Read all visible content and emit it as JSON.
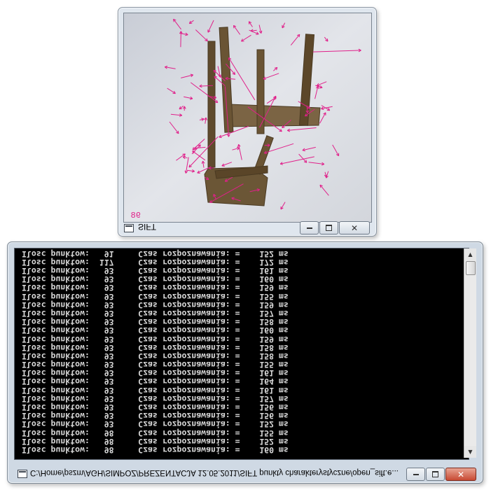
{
  "sift_window": {
    "title": "SIFT",
    "fps_overlay": "98",
    "keypoint_color": "#e0208a",
    "buttons": {
      "minimize": "minimize-icon",
      "maximize": "maximize-icon",
      "close": "close-icon"
    }
  },
  "console_window": {
    "title": "C:/Home/pszm/AGH/SIMPOZ/PREZENTACJA 12.05.2011/SIFT punkty charakterystyczne/open_sift.e...",
    "buttons": {
      "minimize": "minimize-icon",
      "maximize": "maximize-icon",
      "close": "close-icon"
    },
    "lines": [
      "Ilosc punktow:   98     Czas rozpoznawania: =    160 ms",
      "Ilosc punktow:   98     Czas rozpoznawania: =    152 ms",
      "Ilosc punktow:   98     Czas rozpoznawania: =    155 ms",
      "Ilosc punktow:   93     Czas rozpoznawania: =    152 ms",
      "Ilosc punktow:   93     Czas rozpoznawania: =    156 ms",
      "Ilosc punktow:   93     Czas rozpoznawania: =    156 ms",
      "Ilosc punktow:   93     Czas rozpoznawania: =    157 ms",
      "Ilosc punktow:   93     Czas rozpoznawania: =    161 ms",
      "Ilosc punktow:   93     Czas rozpoznawania: =    164 ms",
      "Ilosc punktow:   93     Czas rozpoznawania: =    161 ms",
      "Ilosc punktow:   93     Czas rozpoznawania: =    155 ms",
      "Ilosc punktow:   93     Czas rozpoznawania: =    158 ms",
      "Ilosc punktow:   93     Czas rozpoznawania: =    158 ms",
      "Ilosc punktow:   93     Czas rozpoznawania: =    159 ms",
      "Ilosc punktow:   93     Czas rozpoznawania: =    160 ms",
      "Ilosc punktow:   93     Czas rozpoznawania: =    158 ms",
      "Ilosc punktow:   93     Czas rozpoznawania: =    157 ms",
      "Ilosc punktow:   93     Czas rozpoznawania: =    159 ms",
      "Ilosc punktow:   93     Czas rozpoznawania: =    155 ms",
      "Ilosc punktow:   93     Czas rozpoznawania: =    159 ms",
      "Ilosc punktow:   93     Czas rozpoznawania: =    160 ms",
      "Ilosc punktow:   93     Czas rozpoznawania: =    161 ms",
      "Ilosc punktow:  117     Czas rozpoznawania: =    172 ms",
      "Ilosc punktow:   91     Czas rozpoznawania: =    152 ms"
    ]
  }
}
